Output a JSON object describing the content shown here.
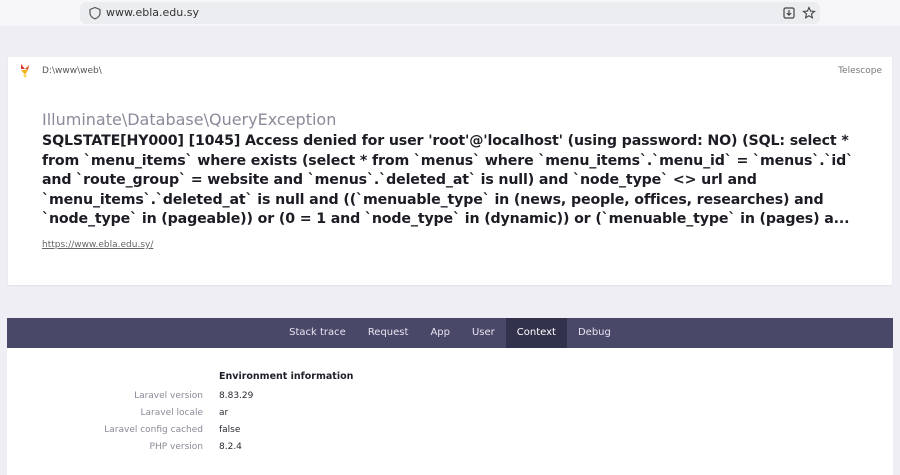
{
  "browser": {
    "url": "www.ebla.edu.sy"
  },
  "header": {
    "path": "D:\\www\\web\\",
    "telescope_label": "Telescope",
    "exception_class": "Illuminate\\Database\\QueryException",
    "exception_message": "SQLSTATE[HY000] [1045] Access denied for user 'root'@'localhost' (using password: NO) (SQL: select * from `menu_items` where exists (select * from `menus` where `menu_items`.`menu_id` = `menus`.`id` and `route_group` = website and `menus`.`deleted_at` is null) and `node_type` <> url and `menu_items`.`deleted_at` is null and ((`menuable_type` in (news, people, offices, researches) and `node_type` in (pageable)) or (0 = 1 and `node_type` in (dynamic)) or (`menuable_type` in (pages) a...",
    "url": "https://www.ebla.edu.sy/"
  },
  "tabs": [
    {
      "label": "Stack trace",
      "active": false
    },
    {
      "label": "Request",
      "active": false
    },
    {
      "label": "App",
      "active": false
    },
    {
      "label": "User",
      "active": false
    },
    {
      "label": "Context",
      "active": true
    },
    {
      "label": "Debug",
      "active": false
    }
  ],
  "environment": {
    "title": "Environment information",
    "rows": [
      {
        "label": "Laravel version",
        "value": "8.83.29"
      },
      {
        "label": "Laravel locale",
        "value": "ar"
      },
      {
        "label": "Laravel config cached",
        "value": "false"
      },
      {
        "label": "PHP version",
        "value": "8.2.4"
      }
    ]
  },
  "colors": {
    "tab_bar": "#4a4868",
    "tab_active": "#33324c",
    "page_background": "#eeeef4"
  },
  "icons": {
    "address_left": "shield-icon",
    "address_right_1": "download-icon",
    "address_right_2": "star-icon",
    "logo": "ignition-logo"
  }
}
